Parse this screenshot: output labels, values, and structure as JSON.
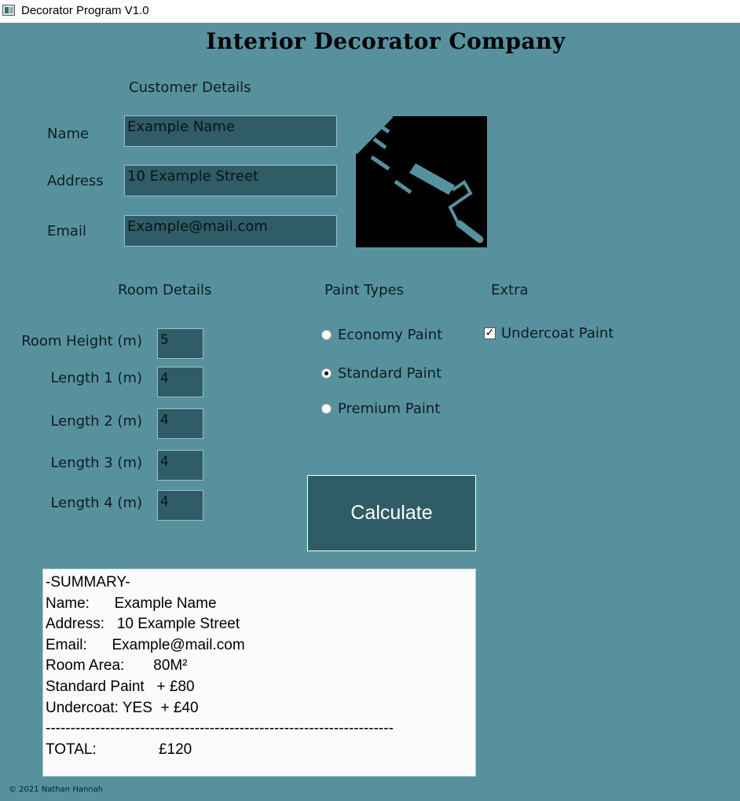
{
  "window": {
    "title": "Decorator Program V1.0"
  },
  "header": {
    "title": "Interior Decorator Company"
  },
  "customer": {
    "section_label": "Customer Details",
    "name_label": "Name",
    "name_value": "Example Name",
    "address_label": "Address",
    "address_value": "10 Example Street",
    "email_label": "Email",
    "email_value": "Example@mail.com",
    "logo_icon": "paint-roller-icon"
  },
  "room": {
    "section_label": "Room Details",
    "height_label": "Room Height (m)",
    "height_value": "5",
    "length1_label": "Length 1 (m)",
    "length1_value": "4",
    "length2_label": "Length 2 (m)",
    "length2_value": "4",
    "length3_label": "Length 3 (m)",
    "length3_value": "4",
    "length4_label": "Length 4 (m)",
    "length4_value": "4"
  },
  "paint": {
    "section_label": "Paint Types",
    "options": [
      "Economy Paint",
      "Standard Paint",
      "Premium Paint"
    ],
    "selected": "Standard Paint"
  },
  "extra": {
    "section_label": "Extra",
    "undercoat_label": "Undercoat Paint",
    "undercoat_checked": true
  },
  "calculate_label": "Calculate",
  "summary": {
    "heading": "-SUMMARY-",
    "name_line": "Name:      Example Name",
    "address_line": "Address:   10 Example Street",
    "email_line": "Email:      Example@mail.com",
    "area_line": "Room Area:       80M²",
    "paint_line": "Standard Paint   + £80",
    "undercoat_line": "Undercoat: YES  + £40",
    "divider": "----------------------------------------------------------------------",
    "total_line": "TOTAL:               £120"
  },
  "footer": {
    "copyright": "© 2021 Nathan Hannah"
  },
  "colors": {
    "background": "#58919e",
    "field": "#2f5c67",
    "button": "#2f5c67"
  }
}
